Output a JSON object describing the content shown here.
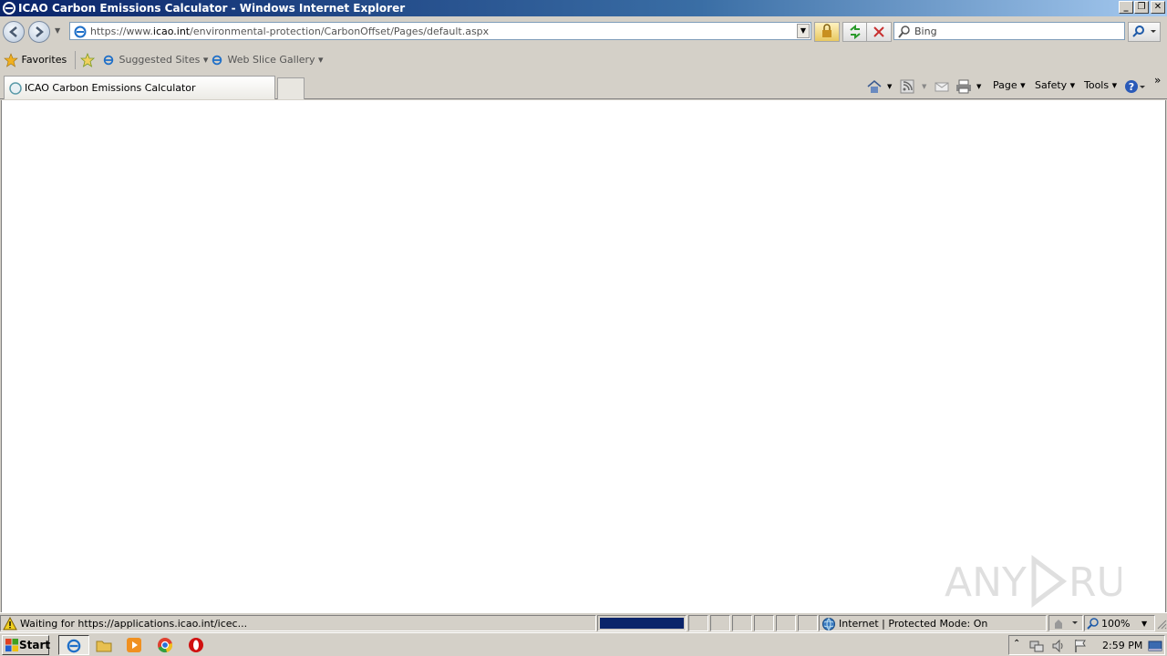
{
  "window": {
    "title": "ICAO Carbon Emissions Calculator - Windows Internet Explorer",
    "controls": {
      "minimize": "_",
      "restore": "❐",
      "close": "✕"
    }
  },
  "address_bar": {
    "url_prefix": "https://www.",
    "url_domain": "icao.int",
    "url_path": "/environmental-protection/CarbonOffset/Pages/default.aspx"
  },
  "search": {
    "placeholder": "Bing"
  },
  "favorites_bar": {
    "favorites_label": "Favorites",
    "items": [
      {
        "label": "Suggested Sites ▾"
      },
      {
        "label": "Web Slice Gallery ▾"
      }
    ]
  },
  "tabs": [
    {
      "label": "ICAO Carbon Emissions Calculator",
      "active": true
    }
  ],
  "command_bar": {
    "page": "Page ▾",
    "safety": "Safety ▾",
    "tools": "Tools ▾",
    "overflow": "»"
  },
  "status_bar": {
    "text": "Waiting for https://applications.icao.int/icec...",
    "progress": 1.0,
    "zone": "Internet | Protected Mode: On",
    "zoom": "100%"
  },
  "taskbar": {
    "start_label": "Start",
    "clock": "2:59 PM"
  },
  "watermark_text": "ANY RUN",
  "colors": {
    "title_bar": "#0a246a",
    "progress": "#0a246a",
    "chrome_bg": "#d4d0c8"
  }
}
